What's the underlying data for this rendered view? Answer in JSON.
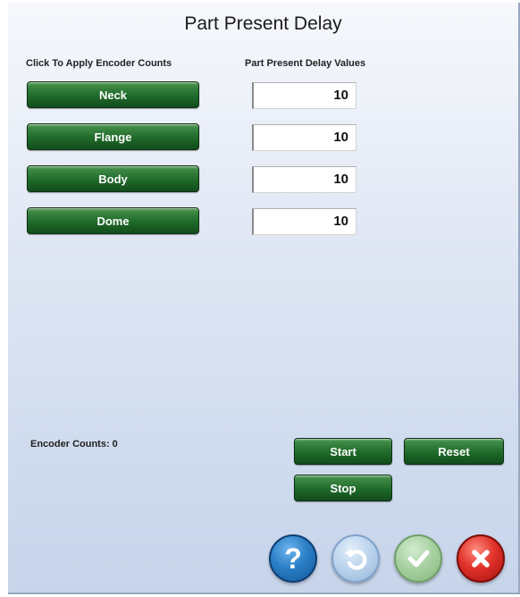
{
  "title": "Part Present Delay",
  "headers": {
    "apply": "Click To Apply Encoder Counts",
    "values": "Part Present Delay Values"
  },
  "rows": [
    {
      "label": "Neck",
      "value": "10"
    },
    {
      "label": "Flange",
      "value": "10"
    },
    {
      "label": "Body",
      "value": "10"
    },
    {
      "label": "Dome",
      "value": "10"
    }
  ],
  "encoder_counts": "Encoder Counts: 0",
  "controls": {
    "start": "Start",
    "reset": "Reset",
    "stop": "Stop"
  },
  "icons": {
    "help": "help-icon",
    "undo": "undo-icon",
    "accept": "check-icon",
    "cancel": "close-icon"
  },
  "colors": {
    "button_green": "#1f6a2a",
    "help_blue": "#1a6fb5",
    "undo_disabled": "#a9c6e4",
    "check_disabled": "#9fc79a",
    "cancel_red": "#d8201e"
  }
}
